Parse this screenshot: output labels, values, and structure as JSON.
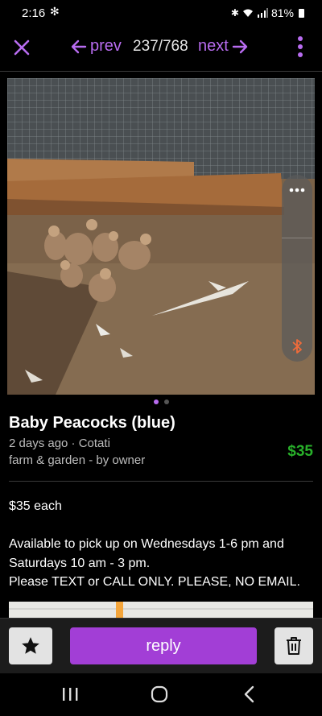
{
  "status_bar": {
    "time": "2:16",
    "battery": "81%",
    "icons": [
      "fan-icon",
      "bluetooth-icon",
      "wifi-icon",
      "signal-icon",
      "battery-icon"
    ]
  },
  "nav": {
    "prev_label": "prev",
    "position": "237/768",
    "next_label": "next"
  },
  "listing": {
    "title": "Baby Peacocks (blue)",
    "posted": "2 days ago · Cotati",
    "category": "farm & garden - by owner",
    "price": "$35",
    "body": [
      "$35 each",
      "Available to pick up on Wednesdays 1-6 pm and Saturdays 10 am - 3 pm.",
      "Please TEXT or CALL ONLY. PLEASE, NO EMAIL."
    ],
    "image_count": 2,
    "active_image": 0
  },
  "actions": {
    "reply_label": "reply"
  },
  "colors": {
    "accent": "#b86cf0",
    "reply_button": "#a23ed6",
    "price": "#28b02a",
    "background": "#000000"
  }
}
